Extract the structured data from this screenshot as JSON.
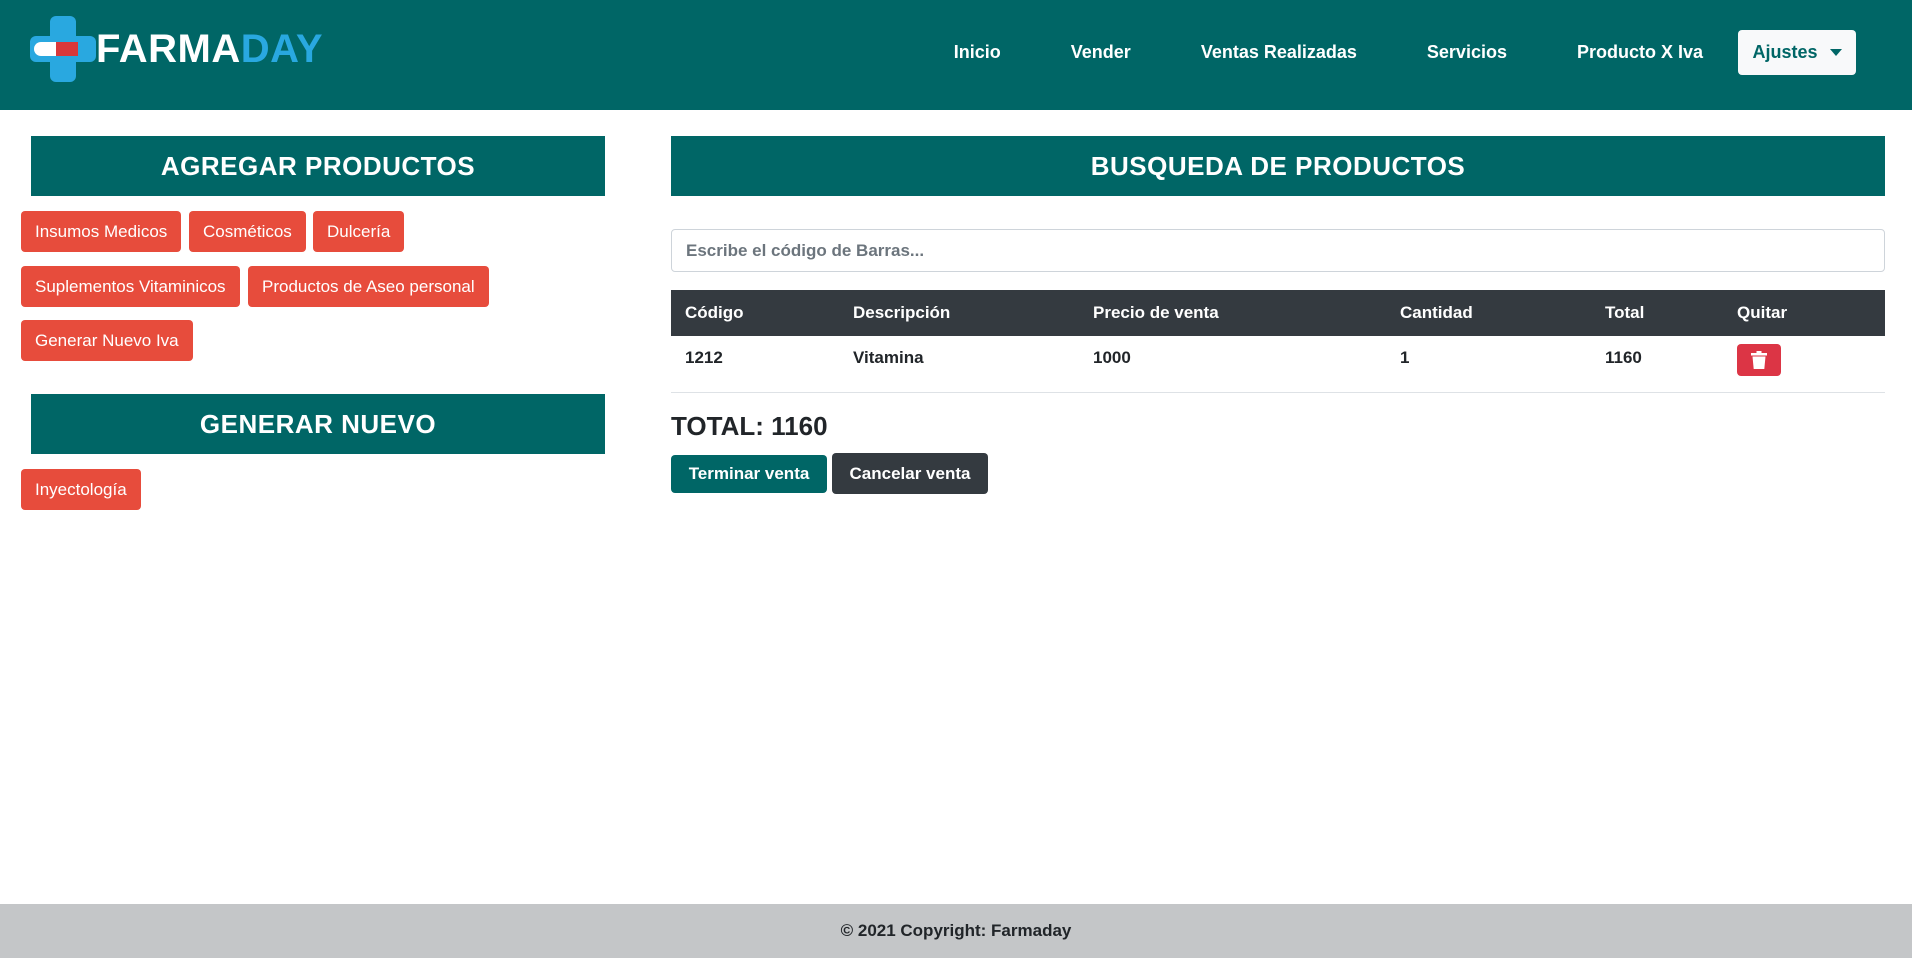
{
  "brand": {
    "part1": "FARMA",
    "part2": "DAY"
  },
  "nav": {
    "links": [
      "Inicio",
      "Vender",
      "Ventas Realizadas",
      "Servicios",
      "Producto X Iva"
    ],
    "settings_label": "Ajustes"
  },
  "left": {
    "add_products_title": "AGREGAR PRODUCTOS",
    "categories": [
      "Insumos Medicos",
      "Cosméticos",
      "Dulcería",
      "Suplementos Vitaminicos",
      "Productos de Aseo personal",
      "Generar Nuevo Iva"
    ],
    "generate_title": "GENERAR NUEVO",
    "generate_items": [
      "Inyectología"
    ]
  },
  "right": {
    "search_title": "BUSQUEDA DE PRODUCTOS",
    "search_placeholder": "Escribe el código de Barras...",
    "table": {
      "headers": [
        "Código",
        "Descripción",
        "Precio de venta",
        "Cantidad",
        "Total",
        "Quitar"
      ],
      "rows": [
        {
          "codigo": "1212",
          "descripcion": "Vitamina",
          "precio": "1000",
          "cantidad": "1",
          "total": "1160"
        }
      ]
    },
    "total_text": "TOTAL: 1160",
    "finish_label": "Terminar venta",
    "cancel_label": "Cancelar venta"
  },
  "footer": {
    "text": "© 2021 Copyright: Farmaday"
  },
  "colors": {
    "primary": "#006666",
    "accent_blue": "#29a8e0",
    "category_red": "#e74c3c",
    "danger": "#dc3545",
    "dark": "#343a40",
    "footer_bg": "#c4c6c8"
  }
}
